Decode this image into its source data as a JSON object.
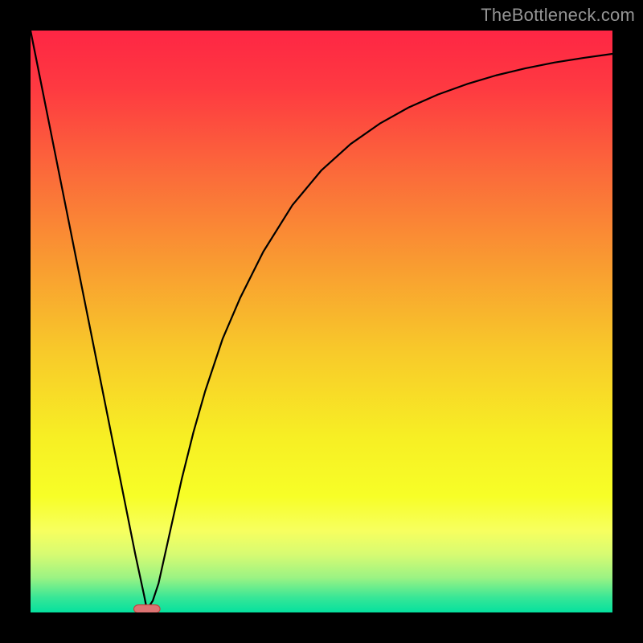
{
  "watermark": "TheBottleneck.com",
  "chart_data": {
    "type": "line",
    "title": "",
    "xlabel": "",
    "ylabel": "",
    "xlim": [
      0,
      100
    ],
    "ylim": [
      0,
      100
    ],
    "grid": false,
    "series": [
      {
        "name": "bottleneck-curve",
        "x": [
          0,
          2,
          4,
          6,
          8,
          10,
          12,
          14,
          16,
          18,
          19.5,
          20,
          21,
          22,
          24,
          26,
          28,
          30,
          33,
          36,
          40,
          45,
          50,
          55,
          60,
          65,
          70,
          75,
          80,
          85,
          90,
          95,
          100
        ],
        "y": [
          100,
          90,
          80,
          70,
          60,
          50,
          40,
          30,
          20,
          10,
          3,
          0.5,
          2,
          5,
          14,
          23,
          31,
          38,
          47,
          54,
          62,
          70,
          76,
          80.5,
          84,
          86.8,
          89,
          90.8,
          92.3,
          93.5,
          94.5,
          95.3,
          96
        ]
      }
    ],
    "background_gradient": {
      "stops": [
        {
          "offset": 0.0,
          "color": "#fe2644"
        },
        {
          "offset": 0.1,
          "color": "#fe3a41"
        },
        {
          "offset": 0.25,
          "color": "#fb6c3a"
        },
        {
          "offset": 0.4,
          "color": "#f99b31"
        },
        {
          "offset": 0.55,
          "color": "#f8c92a"
        },
        {
          "offset": 0.7,
          "color": "#f7ef24"
        },
        {
          "offset": 0.8,
          "color": "#f7fe27"
        },
        {
          "offset": 0.86,
          "color": "#f7ff5f"
        },
        {
          "offset": 0.9,
          "color": "#d7fb72"
        },
        {
          "offset": 0.94,
          "color": "#9cf383"
        },
        {
          "offset": 0.975,
          "color": "#36e697"
        },
        {
          "offset": 1.0,
          "color": "#05e19e"
        }
      ]
    },
    "marker": {
      "x_center": 20,
      "y": 0.6,
      "width_x": 4.5,
      "height_y": 1.4,
      "fill": "#dd7372",
      "stroke": "#c5403d"
    }
  }
}
